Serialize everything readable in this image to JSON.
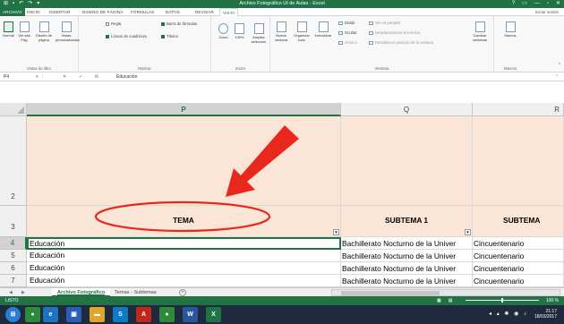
{
  "titlebar": {
    "title": "Archivo Fotográfico UI de Aulas - Excel",
    "qat": [
      "⊞",
      "▪",
      "↶",
      "↷",
      "▾"
    ],
    "controls": [
      "?",
      "▭",
      "—",
      "▫",
      "✕"
    ]
  },
  "menu": {
    "tabs": [
      "ARCHIVO",
      "INICIO",
      "INSERTAR",
      "DISEÑO DE PÁGINA",
      "FÓRMULAS",
      "DATOS",
      "REVISAR",
      "VISTA"
    ],
    "active": "VISTA",
    "signin": "Iniciar sesión"
  },
  "ribbon": {
    "views": {
      "label": "Vistas de libro",
      "buttons": [
        "Normal",
        "Ver salt. Pág.",
        "Diseño de página",
        "Vistas personalizadas"
      ]
    },
    "show": {
      "label": "Mostrar",
      "items": [
        {
          "text": "Regla",
          "checked": false
        },
        {
          "text": "Barra de fórmulas",
          "checked": true
        },
        {
          "text": "Líneas de cuadrícula",
          "checked": true
        },
        {
          "text": "Títulos",
          "checked": true
        }
      ]
    },
    "zoom": {
      "label": "Zoom",
      "buttons": [
        "Zoom",
        "100%",
        "Ampliar selección"
      ]
    },
    "window": {
      "label": "Ventana",
      "buttons": [
        "Nueva ventana",
        "Organizar todo",
        "Inmovilizar"
      ],
      "small": [
        "Dividir",
        "Ocultar",
        "Mostrar"
      ],
      "side": [
        "Ver en paralelo",
        "Desplazamiento sincrónico",
        "Restablecer posición de la ventana"
      ],
      "switch": "Cambiar ventanas"
    },
    "macros": {
      "label": "Macros",
      "button": "Macros"
    }
  },
  "formula_bar": {
    "name": "P4",
    "fx": "fx",
    "value": "Educación"
  },
  "sheet": {
    "columns": [
      "P",
      "Q",
      "R"
    ],
    "row_numbers": [
      "2",
      "3",
      "4",
      "5",
      "6",
      "7"
    ],
    "headers": [
      "TEMA",
      "SUBTEMA 1",
      "SUBTEMA"
    ],
    "rows": [
      [
        "Educación",
        "Bachillerato Nocturno de la Univer",
        "Cincuentenario"
      ],
      [
        "Educación",
        "Bachillerato Nocturno de la Univer",
        "Cincuentenario"
      ],
      [
        "Educación",
        "Bachillerato Nocturno de la Univer",
        "Cincuentenario"
      ],
      [
        "Educación",
        "Bachillerato Nocturno de la Univer",
        "Cincuentenario"
      ]
    ],
    "header_fill": "#fbe5d6"
  },
  "sheet_tabs": {
    "tabs": [
      "Archivo Fotográfico",
      "Temas - Subtemas"
    ],
    "active": "Archivo Fotográfico",
    "add": "+"
  },
  "status": {
    "state": "LISTO",
    "zoom": "100 %"
  },
  "taskbar": {
    "apps": [
      {
        "name": "chrome",
        "color": "#2c8a3a"
      },
      {
        "name": "ie",
        "color": "#1e73be"
      },
      {
        "name": "files",
        "color": "#2a5fb8"
      },
      {
        "name": "explorer",
        "color": "#e0a52a"
      },
      {
        "name": "skype",
        "color": "#0e79c4"
      },
      {
        "name": "acrobat",
        "color": "#c1281b"
      },
      {
        "name": "chrome2",
        "color": "#2c8a3a"
      },
      {
        "name": "word",
        "color": "#2b579a"
      },
      {
        "name": "excel",
        "color": "#217346"
      }
    ],
    "time": "21:17",
    "date": "18/03/2017"
  },
  "annotation": {
    "arrow_color": "#e8281c",
    "ellipse_color": "#e8281c"
  }
}
